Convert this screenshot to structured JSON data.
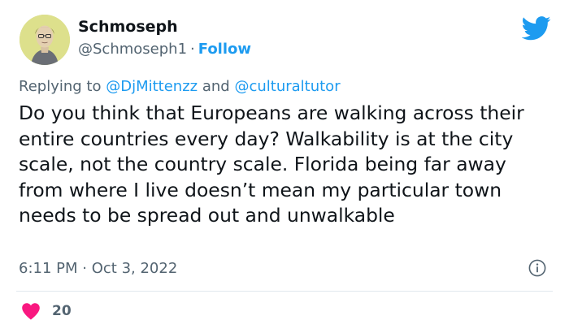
{
  "author": {
    "name": "Schmoseph",
    "handle": "@Schmoseph1",
    "separator": "·",
    "follow_label": "Follow"
  },
  "reply": {
    "prefix": "Replying to",
    "mention_1": "@DjMittenzz",
    "joiner": "and",
    "mention_2": "@culturaltutor"
  },
  "tweet": {
    "text": "Do you think that Europeans are walking across their entire countries every day? Walkability is at the city scale, not the country scale. Florida being far away from where I live doesn’t mean my particular town needs to be spread out and unwalkable",
    "time": "6:11 PM",
    "separator": "·",
    "date": "Oct 3, 2022"
  },
  "engagement": {
    "likes": "20"
  },
  "colors": {
    "accent": "#1d9bf0",
    "heart": "#f91880",
    "muted": "#536471",
    "text": "#0f1419"
  },
  "icons": {
    "brand": "twitter-bird-icon",
    "info": "info-icon",
    "like": "heart-icon"
  }
}
